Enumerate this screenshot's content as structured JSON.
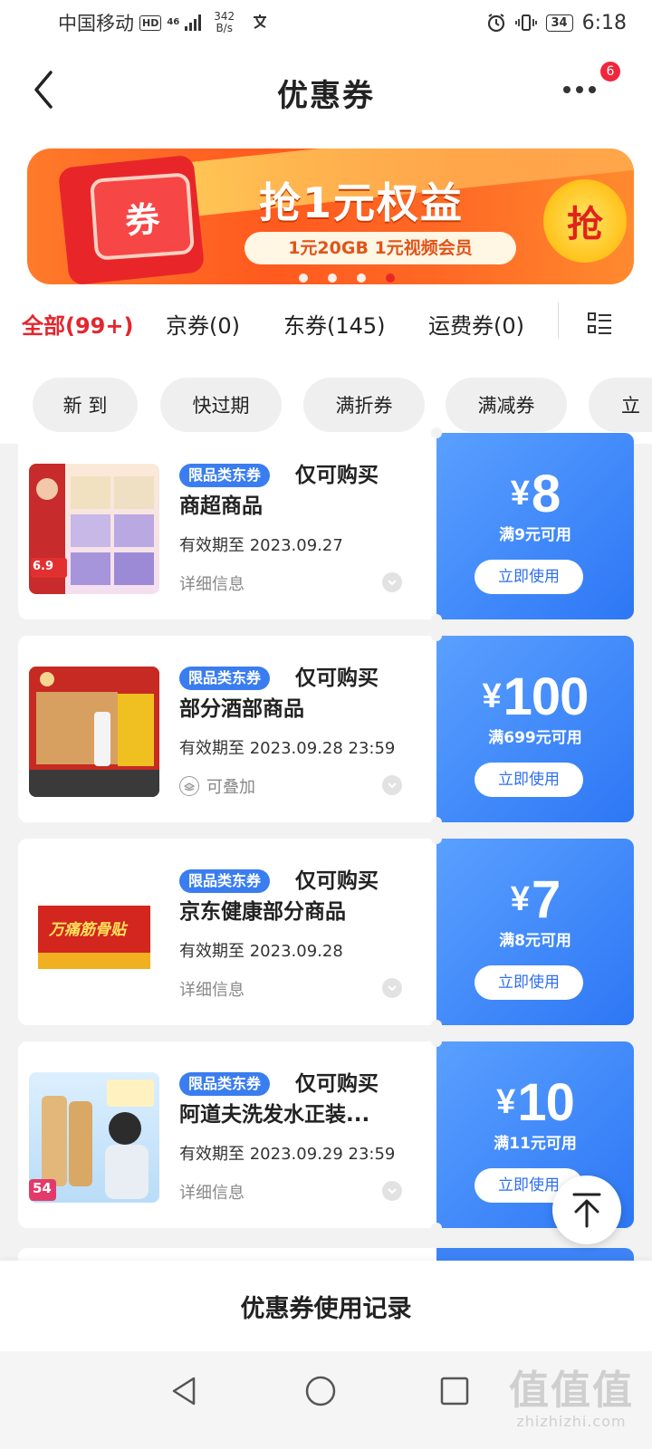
{
  "status_bar": {
    "carrier": "中国移动",
    "hd_badge": "HD",
    "network": "46",
    "speed_value": "342",
    "speed_unit": "B/s",
    "battery": "34",
    "time": "6:18"
  },
  "header": {
    "title": "优惠券",
    "more_badge_count": "6"
  },
  "banner": {
    "coupon_label": "券",
    "headline": "抢1元权益",
    "subline": "1元20GB 1元视频会员",
    "grab_label": "抢",
    "dots": 4,
    "active_dot": 4
  },
  "tabs": [
    {
      "label": "全部(99+)",
      "active": true
    },
    {
      "label": "京券(0)",
      "active": false
    },
    {
      "label": "东券(145)",
      "active": false
    },
    {
      "label": "运费券(0)",
      "active": false
    }
  ],
  "filters": [
    "新 到",
    "快过期",
    "满折券",
    "满减券",
    "立"
  ],
  "coupons": [
    {
      "tag": "限品类东券",
      "title_line1": "仅可购买",
      "title_line2": "商超商品",
      "expiry": "有效期至 2023.09.27",
      "info": "详细信息",
      "currency": "¥",
      "amount": "8",
      "condition": "满9元可用",
      "button": "立即使用"
    },
    {
      "tag": "限品类东券",
      "title_line1": "仅可购买",
      "title_line2": "部分酒部商品",
      "expiry": "有效期至 2023.09.28 23:59",
      "info": "可叠加",
      "currency": "¥",
      "amount": "100",
      "condition": "满699元可用",
      "button": "立即使用"
    },
    {
      "tag": "限品类东券",
      "title_line1": "仅可购买",
      "title_line2": "京东健康部分商品",
      "expiry": "有效期至 2023.09.28",
      "info": "详细信息",
      "currency": "¥",
      "amount": "7",
      "condition": "满8元可用",
      "button": "立即使用"
    },
    {
      "tag": "限品类东券",
      "title_line1": "仅可购买",
      "title_line2": "阿道夫洗发水正装...",
      "expiry": "有效期至 2023.09.29 23:59",
      "info": "详细信息",
      "currency": "¥",
      "amount": "10",
      "condition": "满11元可用",
      "button": "立即使用"
    }
  ],
  "thumbs": {
    "item1_badge": "6.9",
    "item3_label": "万痛筋骨贴",
    "item4_badge": "54"
  },
  "footer": {
    "record_label": "优惠券使用记录"
  },
  "watermark": {
    "logo": "值值值",
    "url": "zhizhizhi.com"
  },
  "colors": {
    "accent_red": "#e4262d",
    "coupon_blue": "#2d77f5",
    "banner_orange": "#ff5a1f"
  }
}
